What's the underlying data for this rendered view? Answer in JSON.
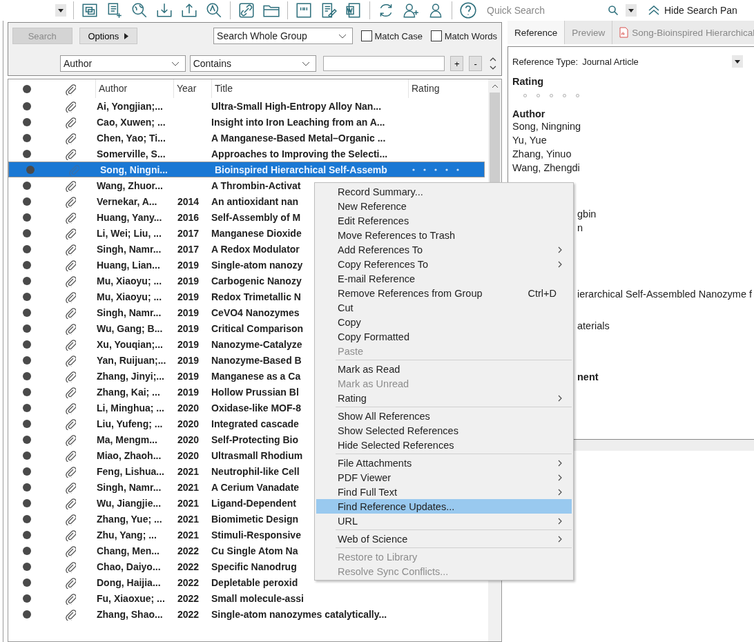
{
  "toolbar": {
    "quick_search": {
      "placeholder": "Quick Search"
    },
    "hide_search_panel": "Hide Search Pan"
  },
  "search_panel": {
    "search_button": {
      "label": "Search",
      "disabled": true
    },
    "options_button": "Options",
    "scope": "Search Whole Group",
    "match_case": {
      "label": "Match Case",
      "checked": false
    },
    "match_words": {
      "label": "Match Words",
      "checked": false
    },
    "field": "Author",
    "operator": "Contains",
    "add_button": "+",
    "remove_button": "-"
  },
  "table": {
    "columns": [
      "Author",
      "Year",
      "Title",
      "Rating"
    ],
    "rows": [
      {
        "author": "Ai, Yongjian;...",
        "year": "",
        "title": "Ultra-Small High-Entropy Alloy Nan...",
        "selected": false
      },
      {
        "author": "Cao, Xuwen; ...",
        "year": "",
        "title": "Insight into Iron Leaching from an A...",
        "selected": false
      },
      {
        "author": "Chen, Yao; Ti...",
        "year": "",
        "title": "A Manganese-Based Metal–Organic ...",
        "selected": false
      },
      {
        "author": "Somerville, S...",
        "year": "",
        "title": "Approaches to Improving the Selecti...",
        "selected": false
      },
      {
        "author": "Song, Ningni...",
        "year": "",
        "title": "Bioinspired Hierarchical Self-Assemb",
        "selected": true
      },
      {
        "author": "Wang, Zhuor...",
        "year": "",
        "title": "A Thrombin-Activat",
        "selected": false
      },
      {
        "author": "Vernekar, A...",
        "year": "2014",
        "title": "An antioxidant nan",
        "selected": false
      },
      {
        "author": "Huang, Yany...",
        "year": "2016",
        "title": "Self-Assembly of M",
        "selected": false
      },
      {
        "author": "Li, Wei; Liu, ...",
        "year": "2017",
        "title": "Manganese Dioxide",
        "selected": false
      },
      {
        "author": "Singh, Namr...",
        "year": "2017",
        "title": "A Redox Modulator",
        "selected": false
      },
      {
        "author": "Huang, Lian...",
        "year": "2019",
        "title": "Single-atom nanozy",
        "selected": false
      },
      {
        "author": "Mu, Xiaoyu; ...",
        "year": "2019",
        "title": "Carbogenic Nanozy",
        "selected": false
      },
      {
        "author": "Mu, Xiaoyu; ...",
        "year": "2019",
        "title": "Redox Trimetallic N",
        "selected": false
      },
      {
        "author": "Singh, Namr...",
        "year": "2019",
        "title": "CeVO4 Nanozymes",
        "selected": false
      },
      {
        "author": "Wu, Gang; B...",
        "year": "2019",
        "title": "Critical Comparison",
        "selected": false
      },
      {
        "author": "Xu, Youqian;...",
        "year": "2019",
        "title": "Nanozyme-Catalyze",
        "selected": false
      },
      {
        "author": "Yan, Ruijuan;...",
        "year": "2019",
        "title": "Nanozyme-Based B",
        "selected": false
      },
      {
        "author": "Zhang, Jinyi;...",
        "year": "2019",
        "title": "Manganese as a Ca",
        "selected": false
      },
      {
        "author": "Zhang, Kai; ...",
        "year": "2019",
        "title": "Hollow Prussian Bl",
        "selected": false
      },
      {
        "author": "Li, Minghua; ...",
        "year": "2020",
        "title": "Oxidase-like MOF-8",
        "selected": false
      },
      {
        "author": "Liu, Yufeng; ...",
        "year": "2020",
        "title": "Integrated cascade",
        "selected": false
      },
      {
        "author": "Ma, Mengm...",
        "year": "2020",
        "title": "Self-Protecting Bio",
        "selected": false
      },
      {
        "author": "Miao, Zhaoh...",
        "year": "2020",
        "title": "Ultrasmall Rhodium",
        "selected": false
      },
      {
        "author": "Feng, Lishua...",
        "year": "2021",
        "title": "Neutrophil-like Cell",
        "selected": false
      },
      {
        "author": "Singh, Namr...",
        "year": "2021",
        "title": "A Cerium Vanadate",
        "selected": false
      },
      {
        "author": "Wu, Jiangjie...",
        "year": "2021",
        "title": "Ligand-Dependent",
        "selected": false
      },
      {
        "author": "Zhang, Yue; ...",
        "year": "2021",
        "title": "Biomimetic Design",
        "selected": false
      },
      {
        "author": "Zhu, Yang; ...",
        "year": "2021",
        "title": "Stimuli-Responsive",
        "selected": false
      },
      {
        "author": "Chang, Men...",
        "year": "2022",
        "title": "Cu Single Atom Na",
        "selected": false
      },
      {
        "author": "Chao, Daiyo...",
        "year": "2022",
        "title": "Specific Nanodrug",
        "selected": false
      },
      {
        "author": "Dong, Haijia...",
        "year": "2022",
        "title": "Depletable peroxid",
        "selected": false
      },
      {
        "author": "Fu, Xiaoxue; ...",
        "year": "2022",
        "title": "Small molecule-assi",
        "selected": false
      },
      {
        "author": "Zhang, Shao...",
        "year": "2022",
        "title": "Single-atom nanozymes catalytically...",
        "selected": false
      }
    ]
  },
  "reference_panel": {
    "tabs": [
      {
        "label": "Reference",
        "selected": true,
        "kind": "text"
      },
      {
        "label": "Preview",
        "selected": false,
        "kind": "text"
      },
      {
        "label": "Song-Bioinspired Hierarchical",
        "selected": false,
        "kind": "pdf"
      }
    ],
    "reference_type_label": "Reference Type:",
    "reference_type": "Journal Article",
    "rating": {
      "heading": "Rating",
      "stars": 0
    },
    "author_heading": "Author",
    "authors": [
      "Song, Ningning",
      "Yu, Yue",
      "Zhang, Yinuo",
      "Wang, Zhengdi"
    ],
    "fragments": [
      {
        "text": "gbin",
        "kind": "text"
      },
      {
        "text": "n",
        "kind": "text"
      },
      {
        "text": "ierarchical Self-Assembled Nanozyme f",
        "kind": "text"
      },
      {
        "text": "aterials",
        "kind": "text"
      },
      {
        "text": "nent",
        "kind": "heading"
      }
    ]
  },
  "context_menu": [
    {
      "kind": "item",
      "label": "Record Summary...",
      "submenu": false,
      "disabled": false,
      "selected": false
    },
    {
      "kind": "item",
      "label": "New Reference",
      "submenu": false,
      "disabled": false,
      "selected": false
    },
    {
      "kind": "item",
      "label": "Edit References",
      "submenu": false,
      "disabled": false,
      "selected": false
    },
    {
      "kind": "item",
      "label": "Move References to Trash",
      "submenu": false,
      "disabled": false,
      "selected": false
    },
    {
      "kind": "item",
      "label": "Add References To",
      "submenu": true,
      "disabled": false,
      "selected": false
    },
    {
      "kind": "item",
      "label": "Copy References To",
      "submenu": true,
      "disabled": false,
      "selected": false
    },
    {
      "kind": "item",
      "label": "E-mail Reference",
      "submenu": false,
      "disabled": false,
      "selected": false
    },
    {
      "kind": "item",
      "label": "Remove References from Group",
      "shortcut": "Ctrl+D",
      "submenu": false,
      "disabled": false,
      "selected": false
    },
    {
      "kind": "item",
      "label": "Cut",
      "submenu": false,
      "disabled": false,
      "selected": false
    },
    {
      "kind": "item",
      "label": "Copy",
      "submenu": false,
      "disabled": false,
      "selected": false
    },
    {
      "kind": "item",
      "label": "Copy Formatted",
      "submenu": false,
      "disabled": false,
      "selected": false
    },
    {
      "kind": "item",
      "label": "Paste",
      "submenu": false,
      "disabled": true,
      "selected": false
    },
    {
      "kind": "separator"
    },
    {
      "kind": "item",
      "label": "Mark as Read",
      "submenu": false,
      "disabled": false,
      "selected": false
    },
    {
      "kind": "item",
      "label": "Mark as Unread",
      "submenu": false,
      "disabled": true,
      "selected": false
    },
    {
      "kind": "item",
      "label": "Rating",
      "submenu": true,
      "disabled": false,
      "selected": false
    },
    {
      "kind": "separator"
    },
    {
      "kind": "item",
      "label": "Show All References",
      "submenu": false,
      "disabled": false,
      "selected": false
    },
    {
      "kind": "item",
      "label": "Show Selected References",
      "submenu": false,
      "disabled": false,
      "selected": false
    },
    {
      "kind": "item",
      "label": "Hide Selected References",
      "submenu": false,
      "disabled": false,
      "selected": false
    },
    {
      "kind": "separator"
    },
    {
      "kind": "item",
      "label": "File Attachments",
      "submenu": true,
      "disabled": false,
      "selected": false
    },
    {
      "kind": "item",
      "label": "PDF Viewer",
      "submenu": true,
      "disabled": false,
      "selected": false
    },
    {
      "kind": "item",
      "label": "Find Full Text",
      "submenu": true,
      "disabled": false,
      "selected": false
    },
    {
      "kind": "item",
      "label": "Find Reference Updates...",
      "submenu": false,
      "disabled": false,
      "selected": true
    },
    {
      "kind": "item",
      "label": "URL",
      "submenu": true,
      "disabled": false,
      "selected": false
    },
    {
      "kind": "separator"
    },
    {
      "kind": "item",
      "label": "Web of Science",
      "submenu": true,
      "disabled": false,
      "selected": false
    },
    {
      "kind": "separator"
    },
    {
      "kind": "item",
      "label": "Restore to Library",
      "submenu": false,
      "disabled": true,
      "selected": false
    },
    {
      "kind": "item",
      "label": "Resolve Sync Conflicts...",
      "submenu": false,
      "disabled": true,
      "selected": false
    }
  ]
}
